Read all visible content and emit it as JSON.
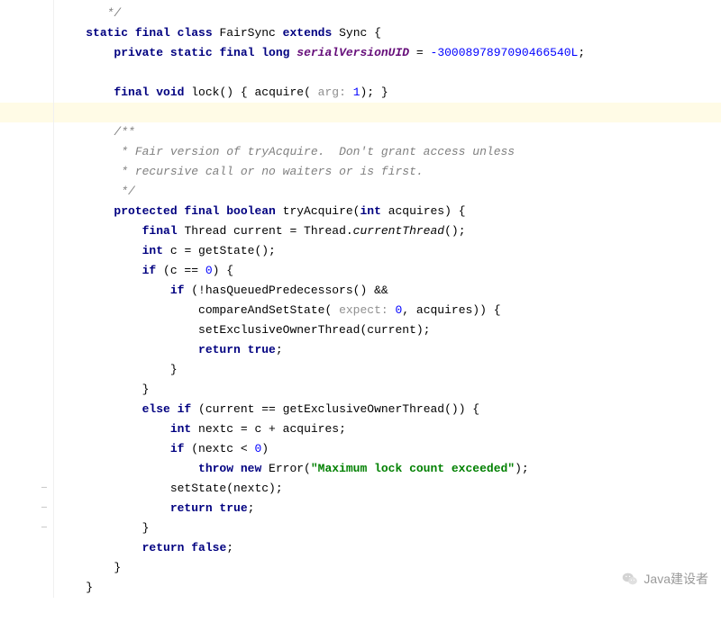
{
  "watermark": {
    "text": "Java建设者"
  },
  "code": {
    "top_comment_end": "*/",
    "class_sig": {
      "mods": "static final class ",
      "name": "FairSync ",
      "ext": "extends ",
      "sup": "Sync {"
    },
    "svu": {
      "mods": "private static final long ",
      "name": "serialVersionUID",
      "eq": " = ",
      "minus": "-",
      "val": "3000897897090466540L",
      "semi": ";"
    },
    "lock": {
      "mods": "final void ",
      "sig": "lock() { acquire(",
      "hint": " arg: ",
      "one": "1",
      "end": "); }"
    },
    "jdoc": {
      "l1": "/**",
      "l2": " * Fair version of tryAcquire.  Don't grant access unless",
      "l3": " * recursive call or no waiters or is first.",
      "l4": " */"
    },
    "try_sig": {
      "mods": "protected final boolean ",
      "name": "tryAcquire(",
      "argkw": "int ",
      "arg": "acquires) {"
    },
    "body": {
      "cur_kw": "final ",
      "cur_rest_a": "Thread current = Thread.",
      "cur_rest_b": "currentThread",
      "cur_rest_c": "();",
      "c_kw": "int ",
      "c_rest": "c = getState();",
      "if1_a": "if ",
      "if1_b": "(c == ",
      "if1_zero": "0",
      "if1_c": ") {",
      "if2_a": "if ",
      "if2_b": "(!hasQueuedPredecessors() &&",
      "cas_a": "compareAndSetState(",
      "cas_hint": " expect: ",
      "cas_zero": "0",
      "cas_b": ", acquires)) {",
      "seot": "setExclusiveOwnerThread(current);",
      "ret_t_kw": "return true",
      "semi": ";",
      "rbrace": "}",
      "else_a": "else if ",
      "else_b": "(current == getExclusiveOwnerThread()) {",
      "nextc_kw": "int ",
      "nextc_rest": "nextc = c + acquires;",
      "if3_a": "if ",
      "if3_b": "(nextc < ",
      "if3_zero": "0",
      "if3_c": ")",
      "throw_a": "throw new ",
      "throw_b": "Error(",
      "throw_str": "\"Maximum lock count exceeded\"",
      "throw_c": ");",
      "setstate": "setState(nextc);",
      "ret_f_kw": "return false"
    }
  }
}
